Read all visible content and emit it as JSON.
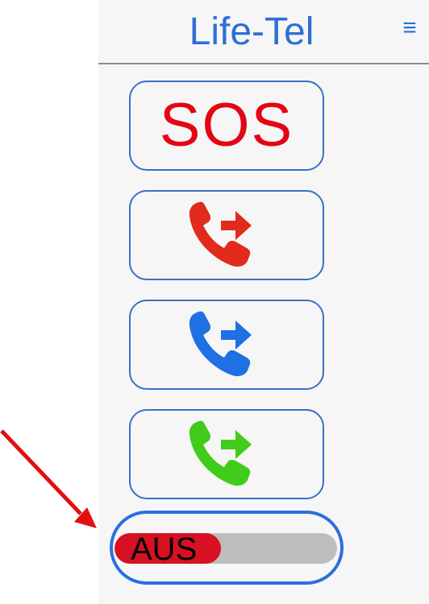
{
  "header": {
    "title": "Life-Tel",
    "menu_icon": "≡"
  },
  "buttons": {
    "sos_label": "SOS",
    "call_red": {
      "icon": "phone-forward-icon",
      "color": "#e02b1d"
    },
    "call_blue": {
      "icon": "phone-forward-icon",
      "color": "#1f6fe5"
    },
    "call_green": {
      "icon": "phone-forward-icon",
      "color": "#3fcc1a"
    }
  },
  "toggle": {
    "label": "AUS",
    "level": 0.48,
    "fill_color": "#d71122",
    "track_color": "#bdbdbd"
  },
  "annotation": {
    "arrow_color": "#e01010"
  }
}
